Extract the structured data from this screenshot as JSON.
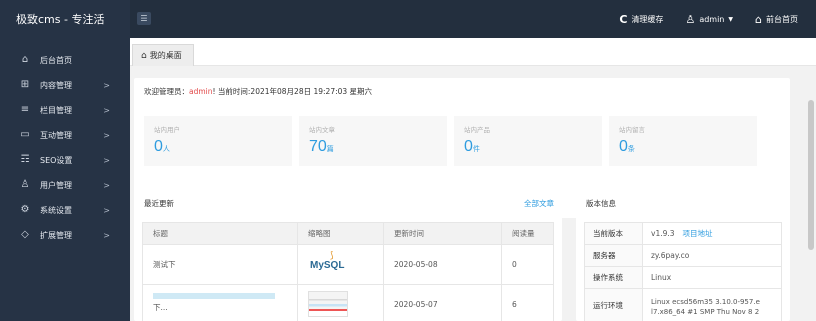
{
  "brand": "极致cms - 专注活",
  "topbar": {
    "actions": [
      {
        "icon": "refresh-icon",
        "glyph": "C",
        "label": "清理缓存"
      },
      {
        "icon": "user-icon",
        "glyph": "♙",
        "label": "admin"
      },
      {
        "icon": "home-icon",
        "glyph": "⌂",
        "label": "前台首页"
      }
    ]
  },
  "sidebar": {
    "items": [
      {
        "label": "后台首页",
        "glyph": "⌂"
      },
      {
        "label": "内容管理",
        "glyph": "⊞"
      },
      {
        "label": "栏目管理",
        "glyph": "≡"
      },
      {
        "label": "互动管理",
        "glyph": "▭"
      },
      {
        "label": "SEO设置",
        "glyph": "☶"
      },
      {
        "label": "用户管理",
        "glyph": "♙"
      },
      {
        "label": "系统设置",
        "glyph": "⚙"
      },
      {
        "label": "扩展管理",
        "glyph": "◇"
      }
    ]
  },
  "tab": {
    "label": "我的桌面"
  },
  "welcome": {
    "prefix": "欢迎管理员：",
    "user": "admin",
    "suffix": "! 当前时间:2021年08月28日 19:27:03 星期六"
  },
  "stats": [
    {
      "label": "站内用户",
      "value": "0",
      "unit": "人"
    },
    {
      "label": "站内文章",
      "value": "70",
      "unit": "篇"
    },
    {
      "label": "站内产品",
      "value": "0",
      "unit": "件"
    },
    {
      "label": "站内留言",
      "value": "0",
      "unit": "条"
    }
  ],
  "updates": {
    "title": "最近更新",
    "all_link": "全部文章",
    "columns": [
      "标题",
      "缩略图",
      "更新时间",
      "阅读量"
    ],
    "rows": [
      {
        "title": "测试下",
        "thumb": "mysql-logo",
        "thumb_text": "MySQL",
        "date": "2020-05-08",
        "views": "0"
      },
      {
        "title": "下...",
        "thumb": "screenshot-thumb",
        "thumb_text": "",
        "date": "2020-05-07",
        "views": "6"
      }
    ]
  },
  "version": {
    "title": "版本信息",
    "rows": [
      {
        "key": "当前版本",
        "value": "v1.9.3",
        "link": "项目地址"
      },
      {
        "key": "服务器",
        "value": "zy.6pay.co",
        "link": ""
      },
      {
        "key": "操作系统",
        "value": "Linux",
        "link": ""
      },
      {
        "key": "运行环境",
        "value": "Linux ecsd56m35 3.10.0-957.e l7.x86_64 #1 SMP Thu Nov 8 2",
        "link": ""
      }
    ]
  },
  "colors": {
    "accent": "#2e9cdf",
    "sidebar": "#263345",
    "topbar": "#232f3e",
    "alert": "#e24a4a"
  }
}
